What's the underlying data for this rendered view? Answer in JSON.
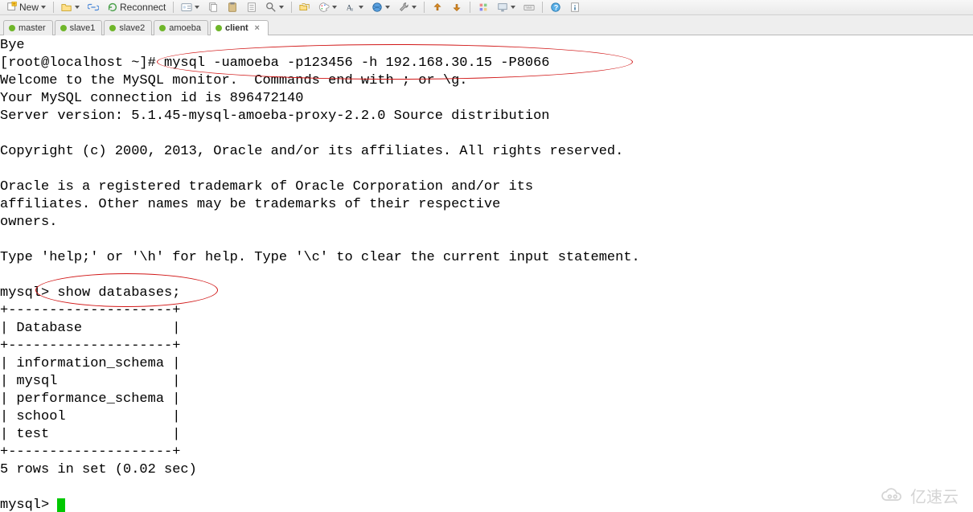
{
  "toolbar": {
    "new_label": "New",
    "reconnect_label": "Reconnect"
  },
  "tabs": [
    {
      "label": "master",
      "status": "#6fb62a",
      "active": false
    },
    {
      "label": "slave1",
      "status": "#6fb62a",
      "active": false
    },
    {
      "label": "slave2",
      "status": "#6fb62a",
      "active": false
    },
    {
      "label": "amoeba",
      "status": "#6fb62a",
      "active": false
    },
    {
      "label": "client",
      "status": "#6fb62a",
      "active": true
    }
  ],
  "term": {
    "l01": "Bye",
    "l02": "[root@localhost ~]# mysql -uamoeba -p123456 -h 192.168.30.15 -P8066",
    "l03": "Welcome to the MySQL monitor.  Commands end with ; or \\g.",
    "l04": "Your MySQL connection id is 896472140",
    "l05": "Server version: 5.1.45-mysql-amoeba-proxy-2.2.0 Source distribution",
    "l06": "",
    "l07": "Copyright (c) 2000, 2013, Oracle and/or its affiliates. All rights reserved.",
    "l08": "",
    "l09": "Oracle is a registered trademark of Oracle Corporation and/or its",
    "l10": "affiliates. Other names may be trademarks of their respective",
    "l11": "owners.",
    "l12": "",
    "l13": "Type 'help;' or '\\h' for help. Type '\\c' to clear the current input statement.",
    "l14": "",
    "l15": "mysql> show databases;",
    "l16": "+--------------------+",
    "l17": "| Database           |",
    "l18": "+--------------------+",
    "l19": "| information_schema |",
    "l20": "| mysql              |",
    "l21": "| performance_schema |",
    "l22": "| school             |",
    "l23": "| test               |",
    "l24": "+--------------------+",
    "l25": "5 rows in set (0.02 sec)",
    "l26": "",
    "l27": "mysql> "
  },
  "annotations": {
    "cmd_highlight": "mysql -uamoeba -p123456 -h 192.168.30.15 -P8066",
    "query_highlight": "show databases;"
  },
  "watermark": {
    "text": "亿速云"
  }
}
